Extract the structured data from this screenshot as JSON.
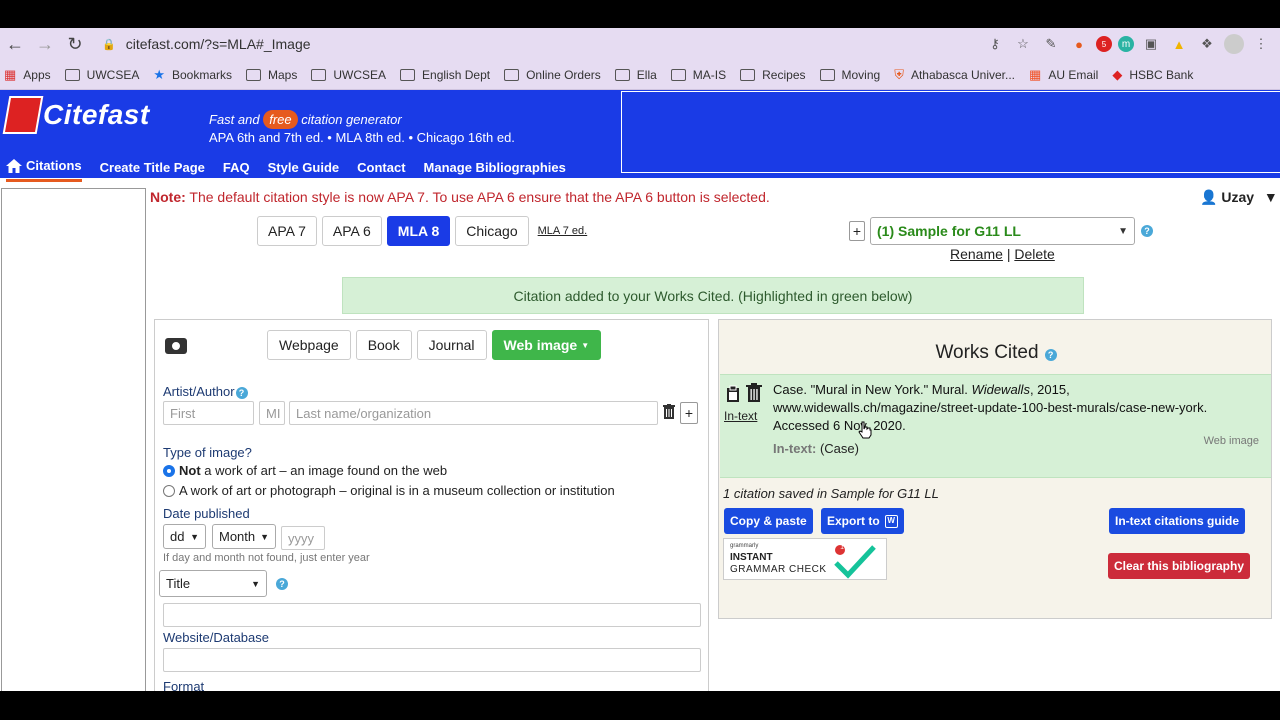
{
  "browser": {
    "url": "citefast.com/?s=MLA#_Image",
    "bookmarks": [
      "Apps",
      "UWCSEA",
      "Bookmarks",
      "Maps",
      "UWCSEA",
      "English Dept",
      "Online Orders",
      "Ella",
      "MA-IS",
      "Recipes",
      "Moving",
      "Athabasca Univer...",
      "AU Email",
      "HSBC Bank"
    ],
    "ext_badge": "5"
  },
  "header": {
    "logo_text": "Citefast",
    "tagline_pre": "Fast and",
    "tagline_free": "free",
    "tagline_post": "citation generator",
    "tagline_line2": "APA 6th and 7th ed. • MLA 8th ed. • Chicago 16th ed.",
    "nav": [
      "Citations",
      "Create Title Page",
      "FAQ",
      "Style Guide",
      "Contact",
      "Manage Bibliographies"
    ]
  },
  "note": {
    "label": "Note:",
    "text": "The default citation style is now APA 7. To use APA 6 ensure that the APA 6 button is selected."
  },
  "user": {
    "name": "Uzay"
  },
  "styles": {
    "tabs": [
      "APA 7",
      "APA 6",
      "MLA 8",
      "Chicago"
    ],
    "active": "MLA 8",
    "edition_link": "MLA 7 ed."
  },
  "bibliography": {
    "selected": "(1) Sample for G11 LL",
    "rename": "Rename",
    "separator": "|",
    "delete": "Delete",
    "plus": "+"
  },
  "notice": "Citation added to your Works Cited. (Highlighted in green below)",
  "form": {
    "source_types": [
      "Webpage",
      "Book",
      "Journal",
      "Web image"
    ],
    "active_source": "Web image",
    "artist_label": "Artist/Author",
    "first_placeholder": "First",
    "mi_placeholder": "MI",
    "last_placeholder": "Last name/organization",
    "add_plus": "+",
    "type_label": "Type of image?",
    "type_opt1_bold": "Not",
    "type_opt1_rest": "a work of art – an image found on the web",
    "type_opt2": "A work of art or photograph – original is in a museum collection or institution",
    "date_label": "Date published",
    "dd": "dd",
    "month": "Month",
    "yyyy_placeholder": "yyyy",
    "date_hint": "If day and month not found, just enter year",
    "title_select": "Title",
    "website_label": "Website/Database",
    "format_label": "Format"
  },
  "works_cited": {
    "title": "Works Cited",
    "entry_line1_pre": "Case. \"Mural in New York.\" Mural.",
    "entry_line1_ital": "Widewalls",
    "entry_line1_post": ", 2015,",
    "entry_line2": "www.widewalls.ch/magazine/street-update-100-best-murals/case-new-york.",
    "entry_line3": "Accessed 6 Nov. 2020.",
    "intext_label": "In-text:",
    "intext_value": "(Case)",
    "entry_type": "Web image",
    "intext_link": "In-text",
    "saved_line": "1 citation saved in Sample for G11 LL",
    "copy_btn": "Copy & paste",
    "export_btn": "Export to",
    "export_icon": "W",
    "intext_guide_btn": "In-text citations guide",
    "clear_btn": "Clear this bibliography",
    "grammarly_small": "grammarly",
    "grammarly_line1": "INSTANT",
    "grammarly_line2": "GRAMMAR CHECK",
    "grammarly_badge": "1"
  },
  "colors": {
    "brand_blue": "#1a3be6",
    "accent_orange": "#e65a1e",
    "success_green": "#3fb64a",
    "danger_red": "#cc2b3a"
  }
}
